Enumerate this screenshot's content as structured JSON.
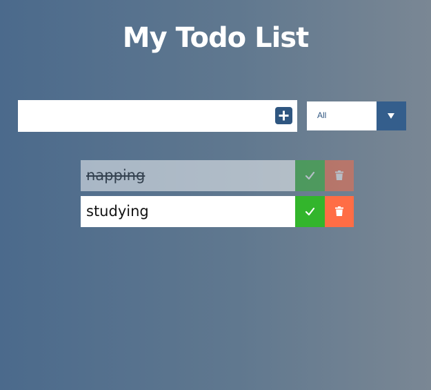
{
  "header": {
    "title": "My Todo List"
  },
  "form": {
    "input_value": "",
    "filter": {
      "selected": "All",
      "options": [
        "All"
      ]
    }
  },
  "todos": [
    {
      "text": "napping",
      "completed": true
    },
    {
      "text": "studying",
      "completed": false
    }
  ],
  "colors": {
    "add_button": "#2f5680",
    "filter_toggle": "#345e8c",
    "complete_button": "#33b52c",
    "delete_button": "#ff6d45"
  },
  "icons": {
    "add": "plus-square-icon",
    "dropdown": "caret-down-icon",
    "complete": "check-icon",
    "delete": "trash-icon"
  }
}
